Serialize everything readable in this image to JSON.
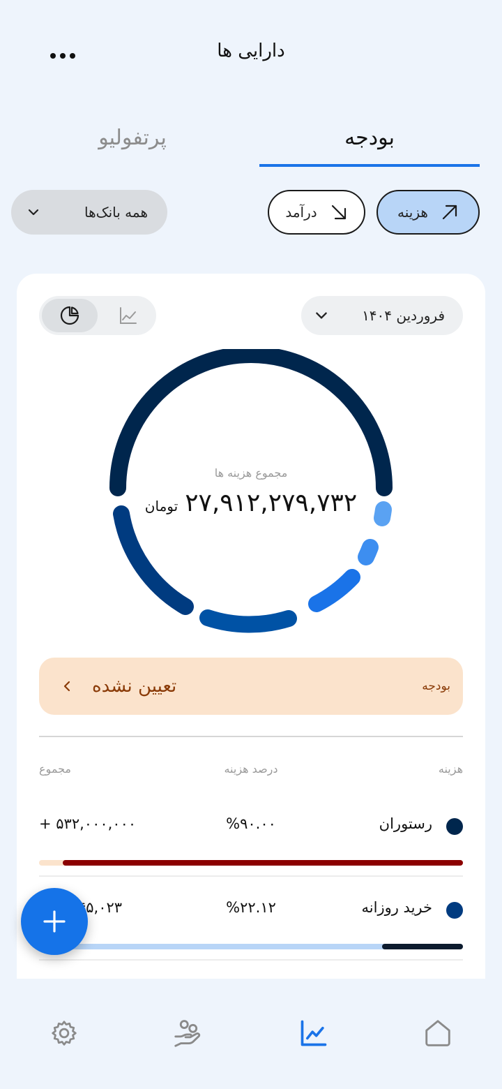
{
  "header": {
    "title": "دارایی ها",
    "more_icon": "more-horizontal-icon"
  },
  "tabs": [
    {
      "label": "بودجه",
      "active": true
    },
    {
      "label": "پرتفولیو",
      "active": false
    }
  ],
  "filters": {
    "banks_label": "همه بانک‌ها",
    "income_label": "درآمد",
    "expense_label": "هزینه",
    "expense_selected": true
  },
  "card": {
    "month_label": "فروردین ۱۴۰۴",
    "view_toggle": {
      "selected": "pie-chart-icon",
      "other": "line-chart-icon"
    },
    "ring": {
      "label": "مجموع هزینه ها",
      "amount": "۲۷,۹۱۲,۲۷۹,۷۳۲",
      "unit": "تومان",
      "colors": [
        "#00264D",
        "#003B80",
        "#0052A5",
        "#1A73E8",
        "#3D8EF0",
        "#5AA2F2"
      ]
    },
    "budget": {
      "key": "بودجه",
      "value": "تعیین نشده"
    },
    "table": {
      "headers": {
        "category": "هزینه",
        "percent": "درصد هزینه",
        "total": "مجموع"
      },
      "rows": [
        {
          "name": "رستوران",
          "percent": "%۹۰.۰۰",
          "total": "+ ۵۳۲,۰۰۰,۰۰۰",
          "dot_color": "#00264D",
          "progress": 0.95,
          "bar_color": "#8B0000",
          "bar_bg": "#FBE3CC"
        },
        {
          "name": "خرید روزانه",
          "percent": "%۲۲.۱۲",
          "total": "۴۵,۰۲۳",
          "dot_color": "#003B80",
          "progress": 0.22,
          "bar_color": "#0D1B2E",
          "bar_bg": "#B8D5F7"
        }
      ]
    }
  },
  "fab": {
    "icon": "plus-icon"
  },
  "bottom_nav": [
    {
      "icon": "settings-icon",
      "active": false
    },
    {
      "icon": "hand-coins-icon",
      "active": false
    },
    {
      "icon": "chart-icon",
      "active": true
    },
    {
      "icon": "home-icon",
      "active": false
    }
  ]
}
